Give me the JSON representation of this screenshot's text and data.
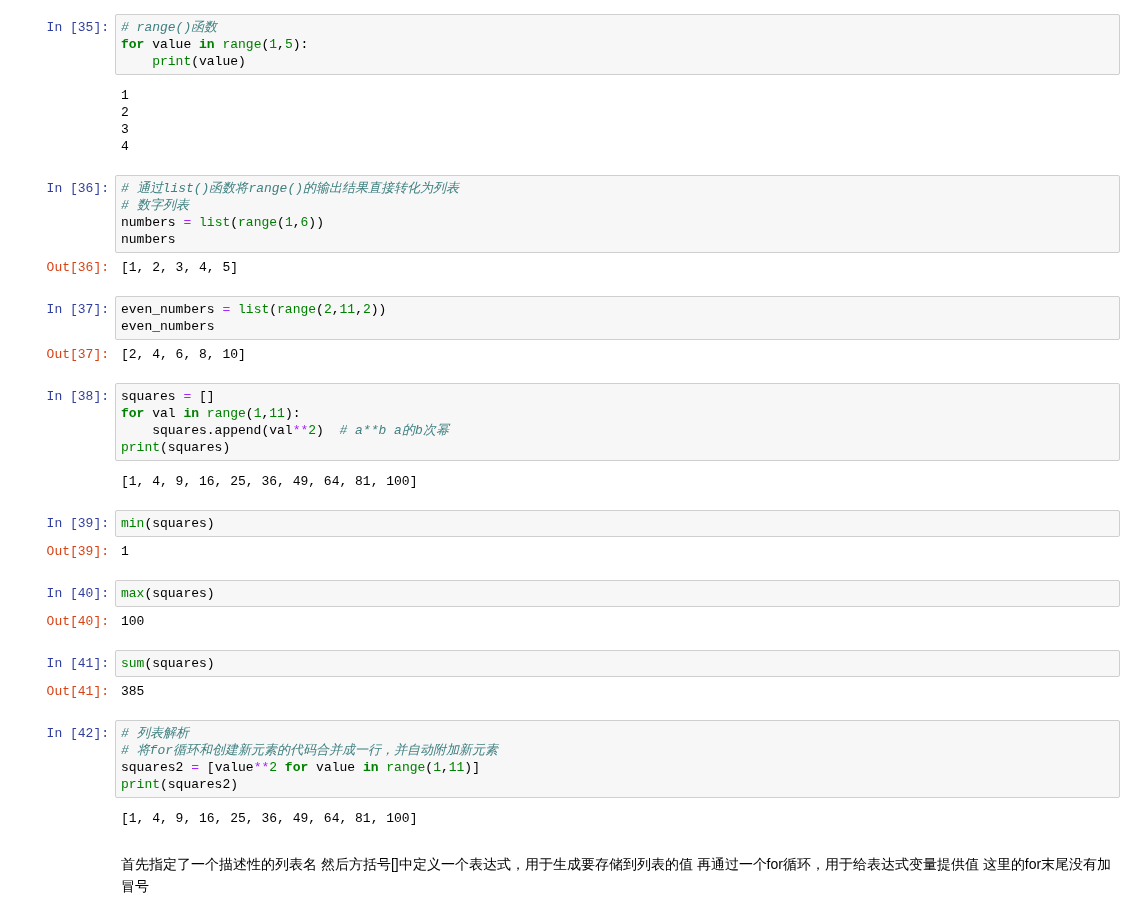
{
  "cells": [
    {
      "prompt": "In [35]:",
      "code": [
        [
          {
            "kind": "comment",
            "text": "# range()函数"
          }
        ],
        [
          {
            "kind": "kw",
            "text": "for"
          },
          {
            "kind": "plain",
            "text": " value "
          },
          {
            "kind": "kw",
            "text": "in"
          },
          {
            "kind": "builtin",
            "text": " range"
          },
          {
            "kind": "plain",
            "text": "("
          },
          {
            "kind": "num",
            "text": "1"
          },
          {
            "kind": "plain",
            "text": ","
          },
          {
            "kind": "num",
            "text": "5"
          },
          {
            "kind": "plain",
            "text": "):"
          }
        ],
        [
          {
            "kind": "builtin",
            "text": "    print"
          },
          {
            "kind": "plain",
            "text": "(value)"
          }
        ]
      ],
      "output": [
        "1",
        "2",
        "3",
        "4"
      ]
    },
    {
      "prompt": "In [36]:",
      "code": [
        [
          {
            "kind": "comment",
            "text": "# 通过list()函数将range()的输出结果直接转化为列表"
          }
        ],
        [
          {
            "kind": "comment",
            "text": "# 数字列表"
          }
        ],
        [
          {
            "kind": "plain",
            "text": "numbers "
          },
          {
            "kind": "op",
            "text": "="
          },
          {
            "kind": "builtin",
            "text": " list"
          },
          {
            "kind": "plain",
            "text": "("
          },
          {
            "kind": "builtin",
            "text": "range"
          },
          {
            "kind": "plain",
            "text": "("
          },
          {
            "kind": "num",
            "text": "1"
          },
          {
            "kind": "plain",
            "text": ","
          },
          {
            "kind": "num",
            "text": "6"
          },
          {
            "kind": "plain",
            "text": "))"
          }
        ],
        [
          {
            "kind": "plain",
            "text": "numbers"
          }
        ]
      ],
      "out_prompt": "Out[36]:",
      "output": [
        "[1, 2, 3, 4, 5]"
      ]
    },
    {
      "prompt": "In [37]:",
      "code": [
        [
          {
            "kind": "plain",
            "text": "even_numbers "
          },
          {
            "kind": "op",
            "text": "="
          },
          {
            "kind": "builtin",
            "text": " list"
          },
          {
            "kind": "plain",
            "text": "("
          },
          {
            "kind": "builtin",
            "text": "range"
          },
          {
            "kind": "plain",
            "text": "("
          },
          {
            "kind": "num",
            "text": "2"
          },
          {
            "kind": "plain",
            "text": ","
          },
          {
            "kind": "num",
            "text": "11"
          },
          {
            "kind": "plain",
            "text": ","
          },
          {
            "kind": "num",
            "text": "2"
          },
          {
            "kind": "plain",
            "text": "))"
          }
        ],
        [
          {
            "kind": "plain",
            "text": "even_numbers"
          }
        ]
      ],
      "out_prompt": "Out[37]:",
      "output": [
        "[2, 4, 6, 8, 10]"
      ]
    },
    {
      "prompt": "In [38]:",
      "code": [
        [
          {
            "kind": "plain",
            "text": "squares "
          },
          {
            "kind": "op",
            "text": "="
          },
          {
            "kind": "plain",
            "text": " []"
          }
        ],
        [
          {
            "kind": "kw",
            "text": "for"
          },
          {
            "kind": "plain",
            "text": " val "
          },
          {
            "kind": "kw",
            "text": "in"
          },
          {
            "kind": "builtin",
            "text": " range"
          },
          {
            "kind": "plain",
            "text": "("
          },
          {
            "kind": "num",
            "text": "1"
          },
          {
            "kind": "plain",
            "text": ","
          },
          {
            "kind": "num",
            "text": "11"
          },
          {
            "kind": "plain",
            "text": "):"
          }
        ],
        [
          {
            "kind": "plain",
            "text": "    squares.append(val"
          },
          {
            "kind": "op",
            "text": "**"
          },
          {
            "kind": "num",
            "text": "2"
          },
          {
            "kind": "plain",
            "text": ")  "
          },
          {
            "kind": "comment",
            "text": "# a**b a的b次幂"
          }
        ],
        [
          {
            "kind": "builtin",
            "text": "print"
          },
          {
            "kind": "plain",
            "text": "(squares)"
          }
        ]
      ],
      "output": [
        "[1, 4, 9, 16, 25, 36, 49, 64, 81, 100]"
      ]
    },
    {
      "prompt": "In [39]:",
      "code": [
        [
          {
            "kind": "builtin",
            "text": "min"
          },
          {
            "kind": "plain",
            "text": "(squares)"
          }
        ]
      ],
      "out_prompt": "Out[39]:",
      "output": [
        "1"
      ]
    },
    {
      "prompt": "In [40]:",
      "code": [
        [
          {
            "kind": "builtin",
            "text": "max"
          },
          {
            "kind": "plain",
            "text": "(squares)"
          }
        ]
      ],
      "out_prompt": "Out[40]:",
      "output": [
        "100"
      ]
    },
    {
      "prompt": "In [41]:",
      "code": [
        [
          {
            "kind": "builtin",
            "text": "sum"
          },
          {
            "kind": "plain",
            "text": "(squares)"
          }
        ]
      ],
      "out_prompt": "Out[41]:",
      "output": [
        "385"
      ]
    },
    {
      "prompt": "In [42]:",
      "code": [
        [
          {
            "kind": "comment",
            "text": "# 列表解析"
          }
        ],
        [
          {
            "kind": "comment",
            "text": "# 将for循环和创建新元素的代码合并成一行，并自动附加新元素"
          }
        ],
        [
          {
            "kind": "plain",
            "text": "squares2 "
          },
          {
            "kind": "op",
            "text": "="
          },
          {
            "kind": "plain",
            "text": " [value"
          },
          {
            "kind": "op",
            "text": "**"
          },
          {
            "kind": "num",
            "text": "2"
          },
          {
            "kind": "kw",
            "text": " for"
          },
          {
            "kind": "plain",
            "text": " value "
          },
          {
            "kind": "kw",
            "text": "in"
          },
          {
            "kind": "builtin",
            "text": " range"
          },
          {
            "kind": "plain",
            "text": "("
          },
          {
            "kind": "num",
            "text": "1"
          },
          {
            "kind": "plain",
            "text": ","
          },
          {
            "kind": "num",
            "text": "11"
          },
          {
            "kind": "plain",
            "text": ")]"
          }
        ],
        [
          {
            "kind": "builtin",
            "text": "print"
          },
          {
            "kind": "plain",
            "text": "(squares2)"
          }
        ]
      ],
      "output": [
        "[1, 4, 9, 16, 25, 36, 49, 64, 81, 100]"
      ]
    }
  ],
  "markdown": "首先指定了一个描述性的列表名 然后方括号[]中定义一个表达式，用于生成要存储到列表的值 再通过一个for循环，用于给表达式变量提供值 这里的for末尾没有加冒号"
}
